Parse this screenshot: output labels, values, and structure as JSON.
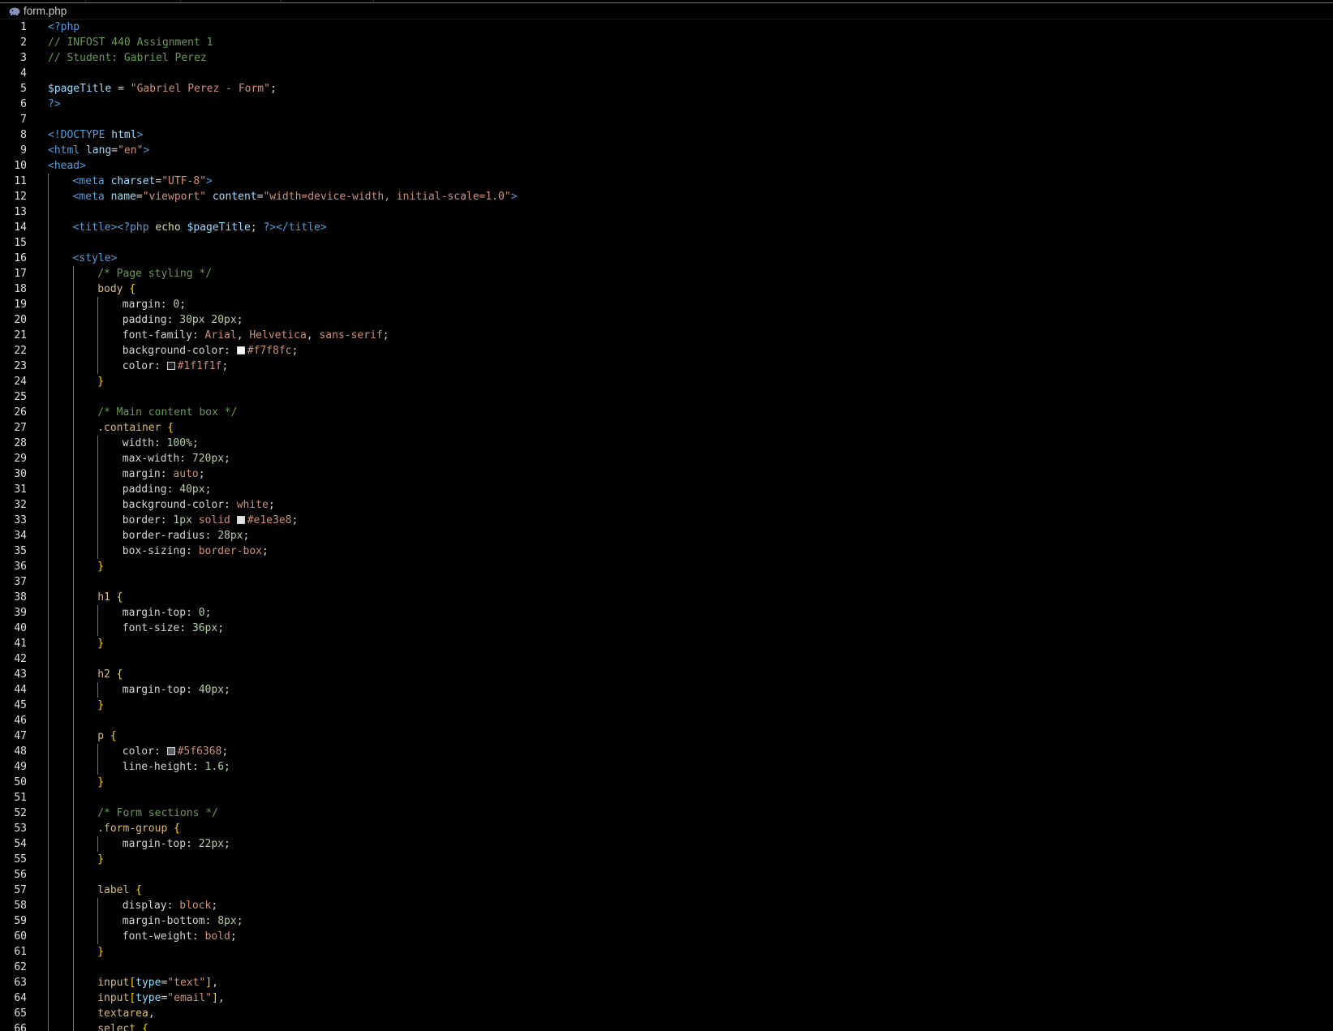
{
  "tabbar": {
    "separators": 4
  },
  "breadcrumb": {
    "icon": "php-elephant-icon",
    "file": "form.php"
  },
  "colors": {
    "accent": "#3d7fb0",
    "line_numbers": "#e0e0e0"
  },
  "lines": [
    {
      "n": "1",
      "indent": 0,
      "t": [
        [
          "php",
          "<?php"
        ]
      ]
    },
    {
      "n": "2",
      "indent": 0,
      "t": [
        [
          "cm",
          "// INFOST 440 Assignment 1"
        ]
      ]
    },
    {
      "n": "3",
      "indent": 0,
      "t": [
        [
          "cm",
          "// Student: Gabriel Perez"
        ]
      ]
    },
    {
      "n": "4",
      "indent": 0,
      "t": []
    },
    {
      "n": "5",
      "indent": 0,
      "t": [
        [
          "var",
          "$pageTitle"
        ],
        [
          "pun",
          " = "
        ],
        [
          "str",
          "\"Gabriel Perez - Form\""
        ],
        [
          "pun",
          ";"
        ]
      ]
    },
    {
      "n": "6",
      "indent": 0,
      "t": [
        [
          "php",
          "?>"
        ]
      ]
    },
    {
      "n": "7",
      "indent": 0,
      "t": []
    },
    {
      "n": "8",
      "indent": 0,
      "t": [
        [
          "tag",
          "<!"
        ],
        [
          "doc",
          "DOCTYPE"
        ],
        [
          "pun",
          " "
        ],
        [
          "attr",
          "html"
        ],
        [
          "tag",
          ">"
        ]
      ]
    },
    {
      "n": "9",
      "indent": 0,
      "t": [
        [
          "tag",
          "<html"
        ],
        [
          "pun",
          " "
        ],
        [
          "attr",
          "lang"
        ],
        [
          "pun",
          "="
        ],
        [
          "str",
          "\"en\""
        ],
        [
          "tag",
          ">"
        ]
      ]
    },
    {
      "n": "10",
      "indent": 0,
      "t": [
        [
          "tag",
          "<head>"
        ]
      ]
    },
    {
      "n": "11",
      "indent": 1,
      "t": [
        [
          "tag",
          "<meta"
        ],
        [
          "pun",
          " "
        ],
        [
          "attr",
          "charset"
        ],
        [
          "pun",
          "="
        ],
        [
          "str",
          "\"UTF-8\""
        ],
        [
          "tag",
          ">"
        ]
      ]
    },
    {
      "n": "12",
      "indent": 1,
      "t": [
        [
          "tag",
          "<meta"
        ],
        [
          "pun",
          " "
        ],
        [
          "attr",
          "name"
        ],
        [
          "pun",
          "="
        ],
        [
          "str",
          "\"viewport\""
        ],
        [
          "pun",
          " "
        ],
        [
          "attr",
          "content"
        ],
        [
          "pun",
          "="
        ],
        [
          "str",
          "\"width=device-width, initial-scale=1.0\""
        ],
        [
          "tag",
          ">"
        ]
      ]
    },
    {
      "n": "13",
      "indent": 1,
      "t": []
    },
    {
      "n": "14",
      "indent": 1,
      "t": [
        [
          "tag",
          "<title>"
        ],
        [
          "php",
          "<?php"
        ],
        [
          "pun",
          " "
        ],
        [
          "fn",
          "echo"
        ],
        [
          "pun",
          " "
        ],
        [
          "var",
          "$pageTitle"
        ],
        [
          "pun",
          "; "
        ],
        [
          "php",
          "?>"
        ],
        [
          "tag",
          "</title>"
        ]
      ]
    },
    {
      "n": "15",
      "indent": 1,
      "t": []
    },
    {
      "n": "16",
      "indent": 1,
      "t": [
        [
          "tag",
          "<style>"
        ]
      ]
    },
    {
      "n": "17",
      "indent": 2,
      "t": [
        [
          "cm",
          "/* Page styling */"
        ]
      ]
    },
    {
      "n": "18",
      "indent": 2,
      "t": [
        [
          "sel",
          "body"
        ],
        [
          "pun",
          " "
        ],
        [
          "br",
          "{"
        ]
      ]
    },
    {
      "n": "19",
      "indent": 3,
      "t": [
        [
          "prop",
          "margin"
        ],
        [
          "pun",
          ": "
        ],
        [
          "num",
          "0"
        ],
        [
          "pun",
          ";"
        ]
      ]
    },
    {
      "n": "20",
      "indent": 3,
      "t": [
        [
          "prop",
          "padding"
        ],
        [
          "pun",
          ": "
        ],
        [
          "num",
          "30px"
        ],
        [
          "pun",
          " "
        ],
        [
          "num",
          "20px"
        ],
        [
          "pun",
          ";"
        ]
      ]
    },
    {
      "n": "21",
      "indent": 3,
      "t": [
        [
          "prop",
          "font-family"
        ],
        [
          "pun",
          ": "
        ],
        [
          "kw",
          "Arial"
        ],
        [
          "pun",
          ", "
        ],
        [
          "kw",
          "Helvetica"
        ],
        [
          "pun",
          ", "
        ],
        [
          "kw",
          "sans-serif"
        ],
        [
          "pun",
          ";"
        ]
      ]
    },
    {
      "n": "22",
      "indent": 3,
      "t": [
        [
          "prop",
          "background-color"
        ],
        [
          "pun",
          ": "
        ],
        [
          "swatch",
          "#f7f8fc"
        ],
        [
          "kw",
          "#f7f8fc"
        ],
        [
          "pun",
          ";"
        ]
      ]
    },
    {
      "n": "23",
      "indent": 3,
      "t": [
        [
          "prop",
          "color"
        ],
        [
          "pun",
          ": "
        ],
        [
          "swatch",
          "#1f1f1f"
        ],
        [
          "kw",
          "#1f1f1f"
        ],
        [
          "pun",
          ";"
        ]
      ]
    },
    {
      "n": "24",
      "indent": 2,
      "t": [
        [
          "br",
          "}"
        ]
      ]
    },
    {
      "n": "25",
      "indent": 2,
      "t": []
    },
    {
      "n": "26",
      "indent": 2,
      "t": [
        [
          "cm",
          "/* Main content box */"
        ]
      ]
    },
    {
      "n": "27",
      "indent": 2,
      "t": [
        [
          "sel",
          ".container"
        ],
        [
          "pun",
          " "
        ],
        [
          "br",
          "{"
        ]
      ]
    },
    {
      "n": "28",
      "indent": 3,
      "t": [
        [
          "prop",
          "width"
        ],
        [
          "pun",
          ": "
        ],
        [
          "num",
          "100%"
        ],
        [
          "pun",
          ";"
        ]
      ]
    },
    {
      "n": "29",
      "indent": 3,
      "t": [
        [
          "prop",
          "max-width"
        ],
        [
          "pun",
          ": "
        ],
        [
          "num",
          "720px"
        ],
        [
          "pun",
          ";"
        ]
      ]
    },
    {
      "n": "30",
      "indent": 3,
      "t": [
        [
          "prop",
          "margin"
        ],
        [
          "pun",
          ": "
        ],
        [
          "kw",
          "auto"
        ],
        [
          "pun",
          ";"
        ]
      ]
    },
    {
      "n": "31",
      "indent": 3,
      "t": [
        [
          "prop",
          "padding"
        ],
        [
          "pun",
          ": "
        ],
        [
          "num",
          "40px"
        ],
        [
          "pun",
          ";"
        ]
      ]
    },
    {
      "n": "32",
      "indent": 3,
      "t": [
        [
          "prop",
          "background-color"
        ],
        [
          "pun",
          ": "
        ],
        [
          "kw",
          "white"
        ],
        [
          "pun",
          ";"
        ]
      ]
    },
    {
      "n": "33",
      "indent": 3,
      "t": [
        [
          "prop",
          "border"
        ],
        [
          "pun",
          ": "
        ],
        [
          "num",
          "1px"
        ],
        [
          "pun",
          " "
        ],
        [
          "kw",
          "solid"
        ],
        [
          "pun",
          " "
        ],
        [
          "swatch",
          "#e1e3e8"
        ],
        [
          "kw",
          "#e1e3e8"
        ],
        [
          "pun",
          ";"
        ]
      ]
    },
    {
      "n": "34",
      "indent": 3,
      "t": [
        [
          "prop",
          "border-radius"
        ],
        [
          "pun",
          ": "
        ],
        [
          "num",
          "28px"
        ],
        [
          "pun",
          ";"
        ]
      ]
    },
    {
      "n": "35",
      "indent": 3,
      "t": [
        [
          "prop",
          "box-sizing"
        ],
        [
          "pun",
          ": "
        ],
        [
          "kw",
          "border-box"
        ],
        [
          "pun",
          ";"
        ]
      ]
    },
    {
      "n": "36",
      "indent": 2,
      "t": [
        [
          "br",
          "}"
        ]
      ]
    },
    {
      "n": "37",
      "indent": 2,
      "t": []
    },
    {
      "n": "38",
      "indent": 2,
      "t": [
        [
          "sel",
          "h1"
        ],
        [
          "pun",
          " "
        ],
        [
          "br",
          "{"
        ]
      ]
    },
    {
      "n": "39",
      "indent": 3,
      "t": [
        [
          "prop",
          "margin-top"
        ],
        [
          "pun",
          ": "
        ],
        [
          "num",
          "0"
        ],
        [
          "pun",
          ";"
        ]
      ]
    },
    {
      "n": "40",
      "indent": 3,
      "t": [
        [
          "prop",
          "font-size"
        ],
        [
          "pun",
          ": "
        ],
        [
          "num",
          "36px"
        ],
        [
          "pun",
          ";"
        ]
      ]
    },
    {
      "n": "41",
      "indent": 2,
      "t": [
        [
          "br",
          "}"
        ]
      ]
    },
    {
      "n": "42",
      "indent": 2,
      "t": []
    },
    {
      "n": "43",
      "indent": 2,
      "t": [
        [
          "sel",
          "h2"
        ],
        [
          "pun",
          " "
        ],
        [
          "br",
          "{"
        ]
      ]
    },
    {
      "n": "44",
      "indent": 3,
      "t": [
        [
          "prop",
          "margin-top"
        ],
        [
          "pun",
          ": "
        ],
        [
          "num",
          "40px"
        ],
        [
          "pun",
          ";"
        ]
      ]
    },
    {
      "n": "45",
      "indent": 2,
      "t": [
        [
          "br",
          "}"
        ]
      ]
    },
    {
      "n": "46",
      "indent": 2,
      "t": []
    },
    {
      "n": "47",
      "indent": 2,
      "t": [
        [
          "sel",
          "p"
        ],
        [
          "pun",
          " "
        ],
        [
          "br",
          "{"
        ]
      ]
    },
    {
      "n": "48",
      "indent": 3,
      "t": [
        [
          "prop",
          "color"
        ],
        [
          "pun",
          ": "
        ],
        [
          "swatch",
          "#5f6368"
        ],
        [
          "kw",
          "#5f6368"
        ],
        [
          "pun",
          ";"
        ]
      ]
    },
    {
      "n": "49",
      "indent": 3,
      "t": [
        [
          "prop",
          "line-height"
        ],
        [
          "pun",
          ": "
        ],
        [
          "num",
          "1.6"
        ],
        [
          "pun",
          ";"
        ]
      ]
    },
    {
      "n": "50",
      "indent": 2,
      "t": [
        [
          "br",
          "}"
        ]
      ]
    },
    {
      "n": "51",
      "indent": 2,
      "t": []
    },
    {
      "n": "52",
      "indent": 2,
      "t": [
        [
          "cm",
          "/* Form sections */"
        ]
      ]
    },
    {
      "n": "53",
      "indent": 2,
      "t": [
        [
          "sel",
          ".form-group"
        ],
        [
          "pun",
          " "
        ],
        [
          "br",
          "{"
        ]
      ]
    },
    {
      "n": "54",
      "indent": 3,
      "t": [
        [
          "prop",
          "margin-top"
        ],
        [
          "pun",
          ": "
        ],
        [
          "num",
          "22px"
        ],
        [
          "pun",
          ";"
        ]
      ]
    },
    {
      "n": "55",
      "indent": 2,
      "t": [
        [
          "br",
          "}"
        ]
      ]
    },
    {
      "n": "56",
      "indent": 2,
      "t": []
    },
    {
      "n": "57",
      "indent": 2,
      "t": [
        [
          "sel",
          "label"
        ],
        [
          "pun",
          " "
        ],
        [
          "br",
          "{"
        ]
      ]
    },
    {
      "n": "58",
      "indent": 3,
      "t": [
        [
          "prop",
          "display"
        ],
        [
          "pun",
          ": "
        ],
        [
          "kw",
          "block"
        ],
        [
          "pun",
          ";"
        ]
      ]
    },
    {
      "n": "59",
      "indent": 3,
      "t": [
        [
          "prop",
          "margin-bottom"
        ],
        [
          "pun",
          ": "
        ],
        [
          "num",
          "8px"
        ],
        [
          "pun",
          ";"
        ]
      ]
    },
    {
      "n": "60",
      "indent": 3,
      "t": [
        [
          "prop",
          "font-weight"
        ],
        [
          "pun",
          ": "
        ],
        [
          "kw",
          "bold"
        ],
        [
          "pun",
          ";"
        ]
      ]
    },
    {
      "n": "61",
      "indent": 2,
      "t": [
        [
          "br",
          "}"
        ]
      ]
    },
    {
      "n": "62",
      "indent": 2,
      "t": []
    },
    {
      "n": "63",
      "indent": 2,
      "t": [
        [
          "sel",
          "input"
        ],
        [
          "br",
          "["
        ],
        [
          "attr",
          "type"
        ],
        [
          "pun",
          "="
        ],
        [
          "str",
          "\"text\""
        ],
        [
          "br",
          "]"
        ],
        [
          "pun",
          ","
        ]
      ]
    },
    {
      "n": "64",
      "indent": 2,
      "t": [
        [
          "sel",
          "input"
        ],
        [
          "br",
          "["
        ],
        [
          "attr",
          "type"
        ],
        [
          "pun",
          "="
        ],
        [
          "str",
          "\"email\""
        ],
        [
          "br",
          "]"
        ],
        [
          "pun",
          ","
        ]
      ]
    },
    {
      "n": "65",
      "indent": 2,
      "t": [
        [
          "sel",
          "textarea"
        ],
        [
          "pun",
          ","
        ]
      ]
    },
    {
      "n": "66",
      "indent": 2,
      "t": [
        [
          "sel",
          "select"
        ],
        [
          "pun",
          " "
        ],
        [
          "br",
          "{"
        ]
      ]
    }
  ]
}
